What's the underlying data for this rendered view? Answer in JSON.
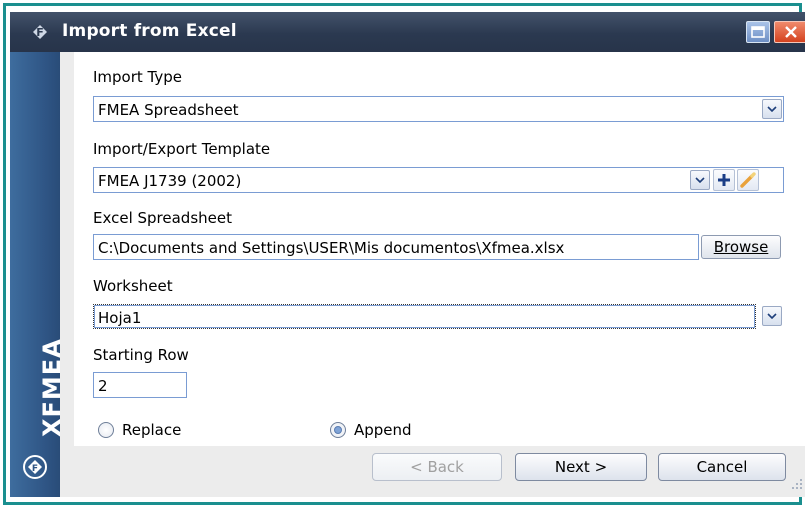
{
  "window": {
    "title": "Import from Excel",
    "brand_text": "XFMEA"
  },
  "form": {
    "import_type": {
      "label": "Import Type",
      "value": "FMEA Spreadsheet"
    },
    "template": {
      "label": "Import/Export Template",
      "value": "FMEA J1739 (2002)"
    },
    "spreadsheet": {
      "label": "Excel Spreadsheet",
      "value": "C:\\Documents and Settings\\USER\\Mis documentos\\Xfmea.xlsx",
      "browse_label": "Browse"
    },
    "worksheet": {
      "label": "Worksheet",
      "value": "Hoja1"
    },
    "starting_row": {
      "label": "Starting Row",
      "value": "2"
    },
    "mode": {
      "options": [
        "Replace",
        "Append"
      ],
      "selected": "Append"
    }
  },
  "buttons": {
    "back": "< Back",
    "next": "Next >",
    "cancel": "Cancel"
  },
  "colors": {
    "titlebar": "#2b3950",
    "sidebar": "#2f5585",
    "frame": "#1a8f8f",
    "field_border": "#7a9cd3"
  },
  "icons": [
    "app-logo-icon",
    "maximize-icon",
    "close-icon",
    "chevron-down-icon",
    "plus-icon",
    "pencil-icon",
    "xfmea-badge-icon",
    "resize-grip-icon"
  ]
}
